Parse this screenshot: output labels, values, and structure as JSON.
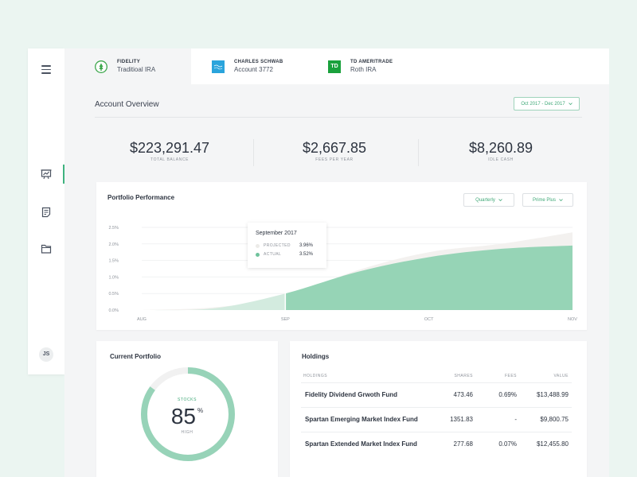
{
  "tabs": [
    {
      "name": "FIDELITY",
      "account": "Traditioal IRA",
      "logo": "fidelity-logo",
      "active": true
    },
    {
      "name": "CHARLES SCHWAB",
      "account": "Account 3772",
      "logo": "schwab-logo",
      "active": false
    },
    {
      "name": "TD AMERITRADE",
      "account": "Roth IRA",
      "logo": "td-logo",
      "logo_text": "TD",
      "active": false
    }
  ],
  "header": {
    "title": "Account Overview",
    "date_range": "Oct 2017 - Dec 2017"
  },
  "stats": [
    {
      "value": "$223,291.47",
      "label": "TOTAL BALANCE"
    },
    {
      "value": "$2,667.85",
      "label": "FEES PER YEAR"
    },
    {
      "value": "$8,260.89",
      "label": "IDLE CASH"
    }
  ],
  "sidebar": {
    "icons": [
      "menu-icon",
      "presentation-chart-icon",
      "document-icon",
      "folder-icon"
    ],
    "active": "presentation-chart-icon",
    "avatar": "JS"
  },
  "performance": {
    "title": "Portfolio Performance",
    "period_select": "Quarterly",
    "plan_select": "Prime Plus",
    "tooltip": {
      "title": "September 2017",
      "projected_label": "PROJECTED",
      "projected_value": "3.96%",
      "actual_label": "ACTUAL",
      "actual_value": "3.52%"
    }
  },
  "chart_data": {
    "type": "area",
    "title": "Portfolio Performance",
    "x": [
      "AUG",
      "SEP",
      "OCT",
      "NOV"
    ],
    "y_ticks": [
      "0.0%",
      "0.5%",
      "1.0%",
      "1.5%",
      "2.0%",
      "2.5%"
    ],
    "ylim": [
      0,
      2.5
    ],
    "series": [
      {
        "name": "PROJECTED",
        "points": [
          [
            0,
            0
          ],
          [
            0.5,
            0.08
          ],
          [
            1,
            0.4
          ],
          [
            1.5,
            1.2
          ],
          [
            2,
            1.75
          ],
          [
            2.5,
            2.0
          ],
          [
            3,
            2.35
          ]
        ]
      },
      {
        "name": "ACTUAL",
        "points": [
          [
            0,
            0
          ],
          [
            0.5,
            0.05
          ],
          [
            1,
            0.5
          ],
          [
            1.5,
            1.15
          ],
          [
            2,
            1.6
          ],
          [
            2.5,
            1.85
          ],
          [
            3,
            1.95
          ]
        ]
      }
    ],
    "highlight_x": 1,
    "colors": {
      "actual": "#96d4b6",
      "actual_pre": "#d3ebdf",
      "projected": "#f3f1ef"
    }
  },
  "portfolio": {
    "title": "Current Portfolio",
    "label": "STOCKS",
    "value": "85",
    "unit": "%",
    "sublabel": "HIGH",
    "progress": 0.85,
    "color": "#97d3b8"
  },
  "holdings": {
    "title": "Holdings",
    "columns": [
      "HOLDINGS",
      "SHARES",
      "FEES",
      "VALUE"
    ],
    "rows": [
      {
        "name": "Fidelity Dividend Grwoth Fund",
        "shares": "473.46",
        "fees": "0.69%",
        "value": "$13,488.99"
      },
      {
        "name": "Spartan Emerging Market Index Fund",
        "shares": "1351.83",
        "fees": "-",
        "value": "$9,800.75"
      },
      {
        "name": "Spartan Extended Market Index Fund",
        "shares": "277.68",
        "fees": "0.07%",
        "value": "$12,455.80"
      }
    ]
  }
}
